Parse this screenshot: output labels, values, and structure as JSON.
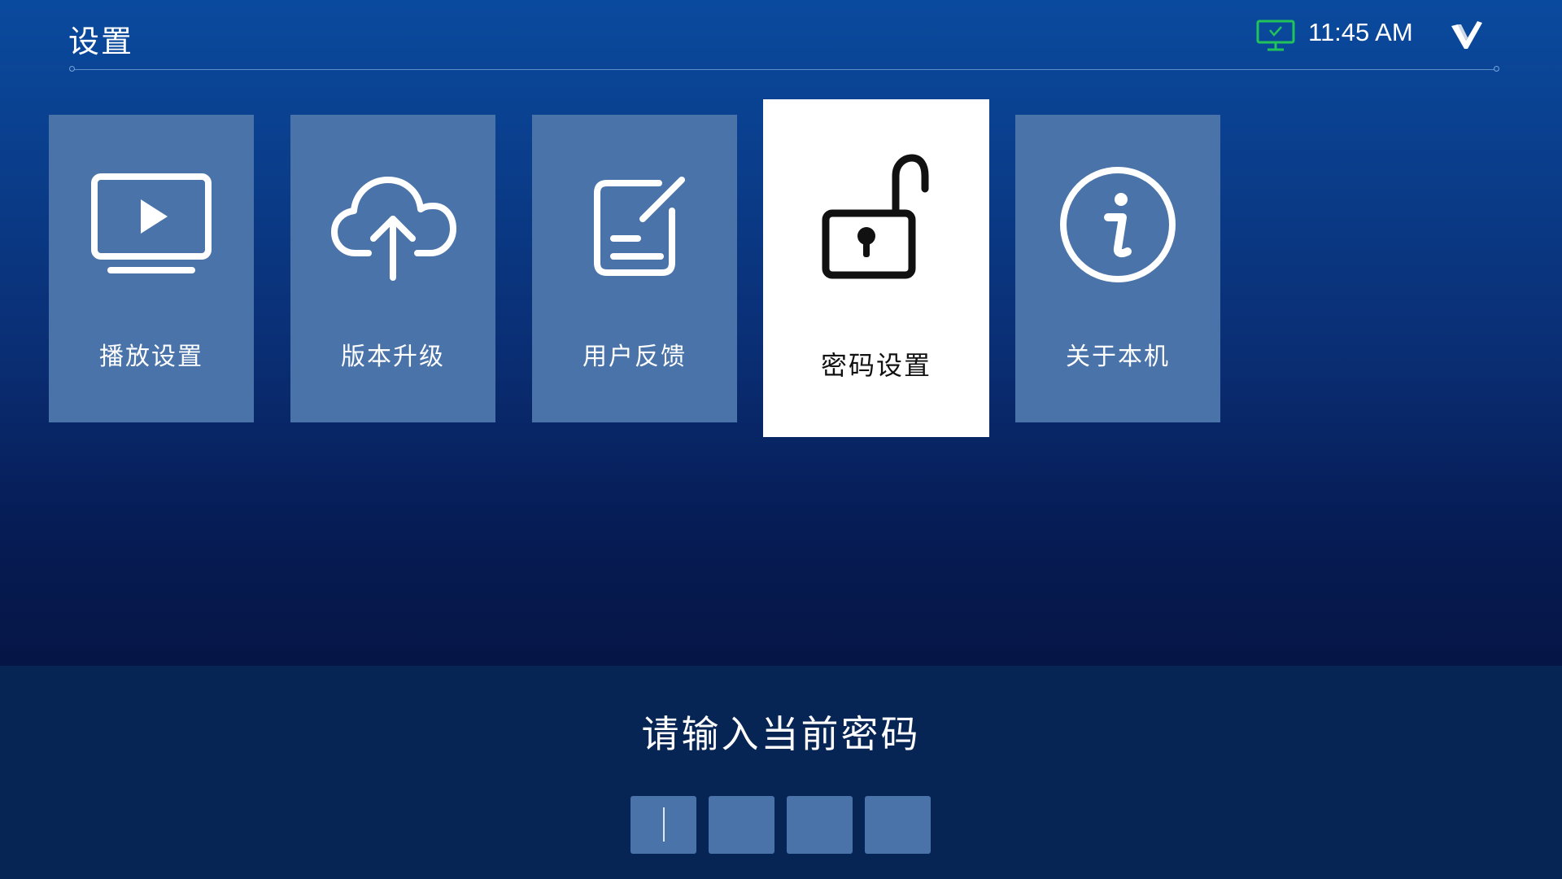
{
  "header": {
    "title": "设置",
    "time": "11:45 AM",
    "status_icon": "monitor-icon",
    "status_icon_color": "#22c35a",
    "brand_icon": "brand-logo-icon"
  },
  "menu": {
    "focused_index": 3,
    "items": [
      {
        "label": "播放设置",
        "icon": "play-screen-icon"
      },
      {
        "label": "版本升级",
        "icon": "cloud-upload-icon"
      },
      {
        "label": "用户反馈",
        "icon": "feedback-edit-icon"
      },
      {
        "label": "密码设置",
        "icon": "unlocked-padlock-icon"
      },
      {
        "label": "关于本机",
        "icon": "info-icon"
      }
    ]
  },
  "password_panel": {
    "prompt": "请输入当前密码",
    "digits": [
      "",
      "",
      "",
      ""
    ],
    "active_digit": 0
  },
  "colors": {
    "tile": "#4a73a9",
    "tile_focused": "#ffffff",
    "panel": "#062454"
  }
}
